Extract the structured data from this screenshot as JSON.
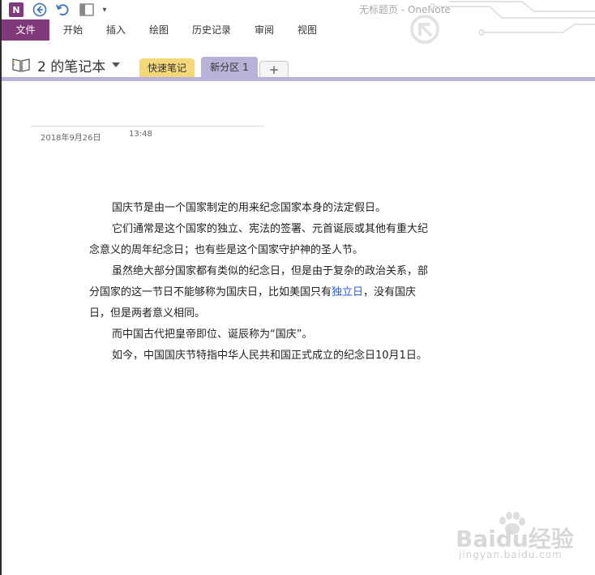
{
  "app": {
    "logo_letter": "N",
    "window_title": "无标题页 - OneNote",
    "accent_color": "#80397b"
  },
  "ribbon": {
    "tabs": [
      "文件",
      "开始",
      "插入",
      "绘图",
      "历史记录",
      "审阅",
      "视图"
    ]
  },
  "notebook": {
    "name": "2 的笔记本",
    "sections": [
      {
        "label": "快速笔记",
        "color": "#f5d77a"
      },
      {
        "label": "新分区 1",
        "color": "#b9b1d8",
        "active": true
      }
    ],
    "add_section_label": "+"
  },
  "page": {
    "date": "2018年9月26日",
    "time": "13:48",
    "paragraphs": [
      "国庆节是由一个国家制定的用来纪念国家本身的法定假日。",
      "它们通常是这个国家的独立、宪法的签署、元首诞辰或其他有重大纪念意义的周年纪念日；也有些是这个国家守护神的圣人节。",
      {
        "before": "虽然绝大部分国家都有类似的纪念日，但是由于复杂的政治关系，部分国家的这一节日不能够称为国庆日，比如美国只有",
        "link": "独立日",
        "after": "，没有国庆日，但是两者意义相同。"
      },
      "而中国古代把皇帝即位、诞辰称为“国庆”。",
      "如今，中国国庆节特指中华人民共和国正式成立的纪念日10月1日。"
    ]
  },
  "watermark": {
    "logo": "Baidu经验",
    "url": "jingyan.baidu.com"
  }
}
